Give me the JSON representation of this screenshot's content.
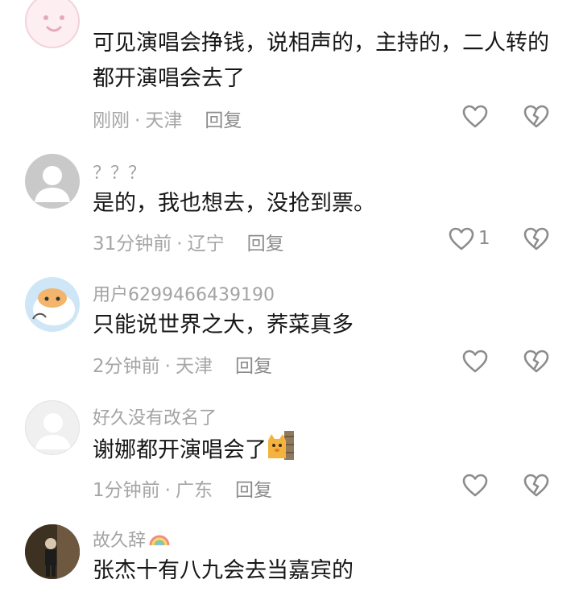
{
  "comments": [
    {
      "username": "",
      "text": "可见演唱会挣钱，说相声的，主持的，二人转的都开演唱会去了",
      "time": "刚刚",
      "location": "天津",
      "reply_label": "回复",
      "like_count": "",
      "avatar_icon": "smiley-face-avatar"
    },
    {
      "username": "？？？",
      "text": "是的，我也想去，没抢到票。",
      "time": "31分钟前",
      "location": "辽宁",
      "reply_label": "回复",
      "like_count": "1",
      "avatar_icon": "default-user-avatar"
    },
    {
      "username": "用户6299466439190",
      "text": "只能说世界之大，荞菜真多",
      "time": "2分钟前",
      "location": "天津",
      "reply_label": "回复",
      "like_count": "",
      "avatar_icon": "cartoon-cat-avatar"
    },
    {
      "username": "好久没有改名了",
      "text": "谢娜都开演唱会了",
      "time": "1分钟前",
      "location": "广东",
      "reply_label": "回复",
      "like_count": "",
      "avatar_icon": "default-user-avatar",
      "emoji": "cat-peeking-emoji"
    },
    {
      "username": "故久辞",
      "text": "张杰十有八九会去当嘉宾的",
      "time": "",
      "location": "",
      "reply_label": "",
      "like_count": "",
      "avatar_icon": "photo-avatar",
      "name_emoji": "rainbow-emoji"
    }
  ],
  "meta_separator": "·",
  "colors": {
    "text": "#161616",
    "muted": "#a6a6a6",
    "icon": "#8c8c8c"
  }
}
